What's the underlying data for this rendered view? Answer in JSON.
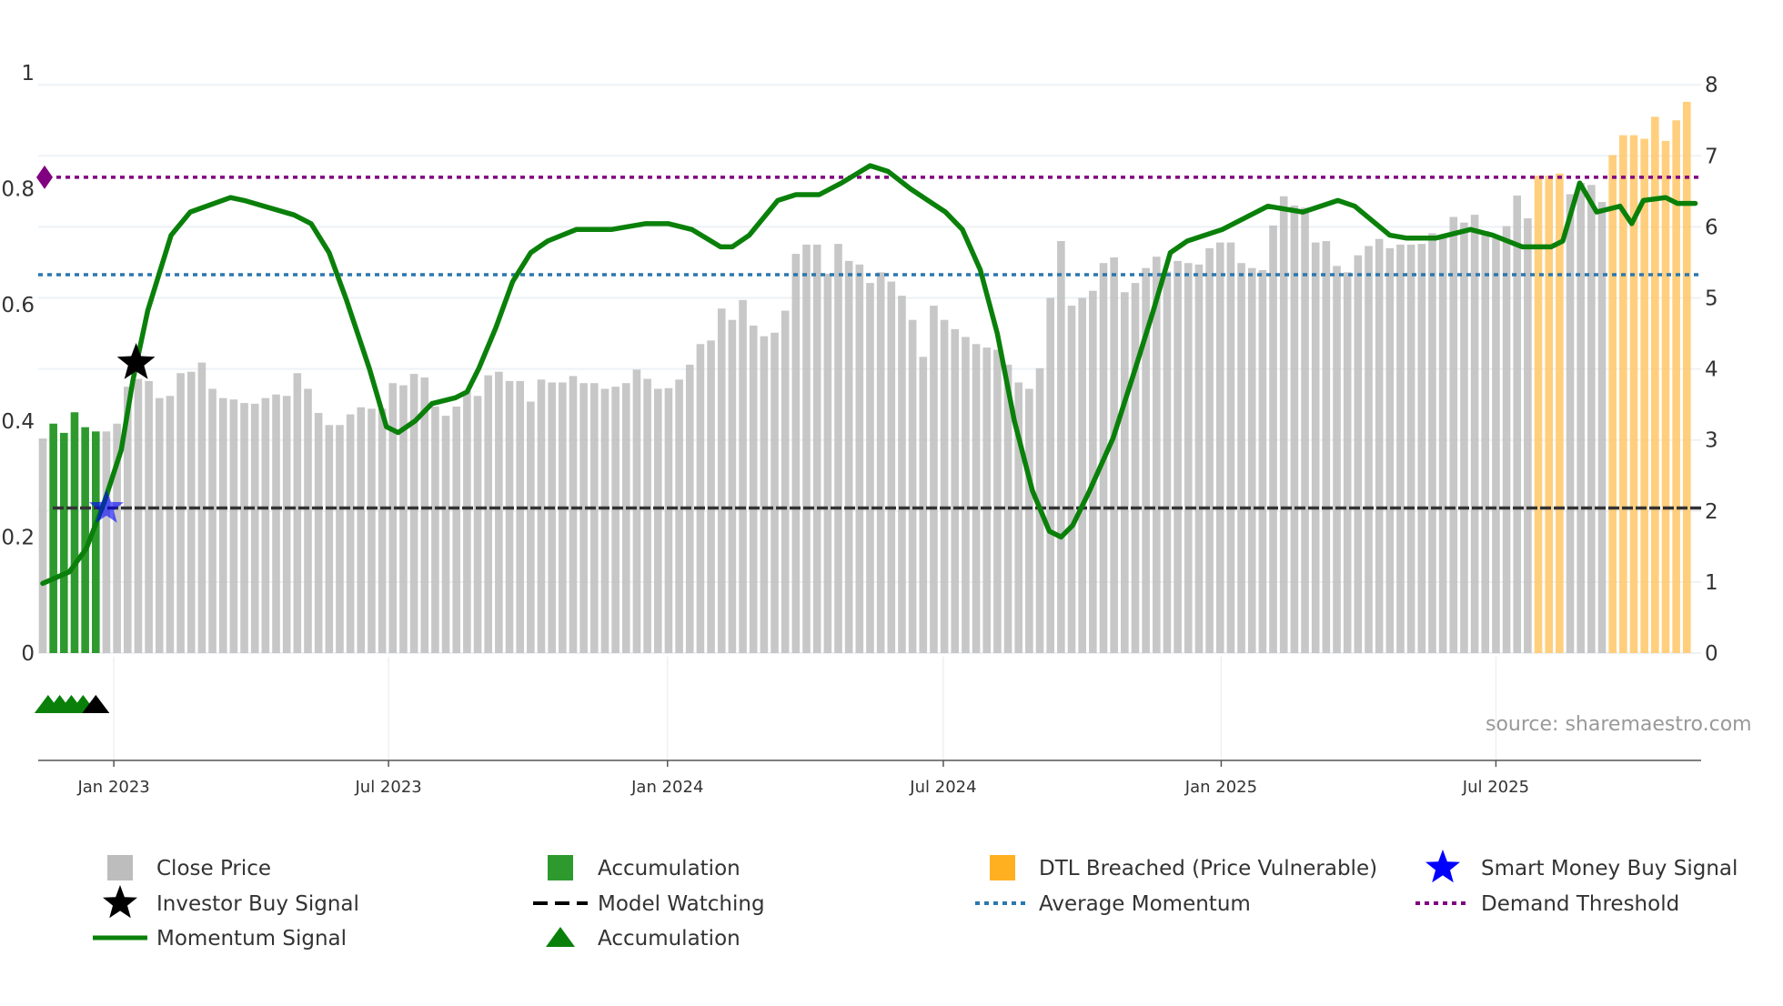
{
  "chart_data": {
    "type": "bar",
    "title": "",
    "x_unit": "week index (weekly bars, first bar mid-Nov 2022)",
    "x_ticks": [
      {
        "label": "Jan 2023",
        "week": 6.7
      },
      {
        "label": "Jul 2023",
        "week": 32.6
      },
      {
        "label": "Jan 2024",
        "week": 58.9
      },
      {
        "label": "Jul 2024",
        "week": 84.9
      },
      {
        "label": "Jan 2025",
        "week": 111.1
      },
      {
        "label": "Jul 2025",
        "week": 137
      }
    ],
    "left_axis": {
      "range": [
        0,
        1
      ],
      "ticks": [
        "0",
        "0.2",
        "0.4",
        "0.6",
        "0.8",
        "1"
      ],
      "tick_values": [
        0,
        0.2,
        0.4,
        0.6,
        0.8,
        1
      ]
    },
    "right_axis": {
      "range": [
        0,
        8
      ],
      "ticks": [
        "0",
        "1",
        "2",
        "3",
        "4",
        "5",
        "6",
        "7",
        "8"
      ],
      "tick_values": [
        0,
        1,
        2,
        3,
        4,
        5,
        6,
        7,
        8
      ]
    },
    "close_price": [
      3.02,
      3.23,
      3.1,
      3.39,
      3.18,
      3.12,
      3.12,
      3.23,
      3.75,
      3.86,
      3.83,
      3.59,
      3.62,
      3.94,
      3.96,
      4.09,
      3.72,
      3.59,
      3.57,
      3.52,
      3.51,
      3.59,
      3.64,
      3.62,
      3.94,
      3.72,
      3.38,
      3.21,
      3.21,
      3.36,
      3.46,
      3.44,
      3.44,
      3.8,
      3.77,
      3.93,
      3.88,
      3.47,
      3.34,
      3.47,
      3.69,
      3.62,
      3.91,
      3.96,
      3.83,
      3.83,
      3.54,
      3.85,
      3.81,
      3.81,
      3.9,
      3.8,
      3.8,
      3.72,
      3.75,
      3.8,
      3.99,
      3.86,
      3.72,
      3.73,
      3.85,
      4.06,
      4.35,
      4.4,
      4.85,
      4.69,
      4.97,
      4.61,
      4.46,
      4.51,
      4.82,
      5.62,
      5.75,
      5.75,
      5.34,
      5.76,
      5.52,
      5.47,
      5.21,
      5.36,
      5.23,
      5.03,
      4.69,
      4.17,
      4.89,
      4.69,
      4.56,
      4.45,
      4.35,
      4.3,
      4.27,
      4.06,
      3.81,
      3.72,
      4.01,
      5.0,
      5.8,
      4.89,
      5.0,
      5.1,
      5.49,
      5.57,
      5.08,
      5.21,
      5.42,
      5.58,
      5.37,
      5.52,
      5.49,
      5.47,
      5.7,
      5.78,
      5.78,
      5.49,
      5.42,
      5.39,
      6.02,
      6.43,
      6.3,
      6.27,
      5.78,
      5.8,
      5.45,
      5.36,
      5.6,
      5.73,
      5.83,
      5.7,
      5.75,
      5.75,
      5.76,
      5.91,
      5.86,
      6.14,
      6.06,
      6.17,
      5.94,
      5.84,
      6.01,
      6.44,
      6.12,
      6.72,
      6.72,
      6.75,
      6.46,
      6.62,
      6.59,
      6.35,
      7.01,
      7.29,
      7.29,
      7.24,
      7.55,
      7.21,
      7.5,
      7.76
    ],
    "accumulation_bars": [
      1,
      2,
      3,
      4,
      5
    ],
    "dtl_breached_bars": [
      141,
      142,
      143,
      148,
      149,
      150,
      151,
      152,
      153,
      154,
      155
    ],
    "momentum_signal": [
      [
        0,
        0.12
      ],
      [
        2.5,
        0.14
      ],
      [
        4.1,
        0.18
      ],
      [
        5.8,
        0.26
      ],
      [
        7.4,
        0.35
      ],
      [
        8.5,
        0.47
      ],
      [
        9.9,
        0.59
      ],
      [
        12.1,
        0.72
      ],
      [
        13.9,
        0.76
      ],
      [
        17.7,
        0.785
      ],
      [
        19,
        0.78
      ],
      [
        23.7,
        0.755
      ],
      [
        25.3,
        0.74
      ],
      [
        27,
        0.69
      ],
      [
        28.6,
        0.61
      ],
      [
        30.8,
        0.49
      ],
      [
        32.4,
        0.39
      ],
      [
        33.5,
        0.38
      ],
      [
        35.1,
        0.4
      ],
      [
        36.7,
        0.43
      ],
      [
        38.9,
        0.44
      ],
      [
        40,
        0.45
      ],
      [
        41.1,
        0.49
      ],
      [
        42.7,
        0.56
      ],
      [
        44.3,
        0.64
      ],
      [
        46,
        0.69
      ],
      [
        47.6,
        0.71
      ],
      [
        50.3,
        0.73
      ],
      [
        53.6,
        0.73
      ],
      [
        56.8,
        0.74
      ],
      [
        59,
        0.74
      ],
      [
        61.2,
        0.73
      ],
      [
        63.9,
        0.7
      ],
      [
        65,
        0.7
      ],
      [
        66.6,
        0.72
      ],
      [
        69.3,
        0.78
      ],
      [
        71,
        0.79
      ],
      [
        73.2,
        0.79
      ],
      [
        75.3,
        0.81
      ],
      [
        78,
        0.84
      ],
      [
        79.7,
        0.83
      ],
      [
        81.8,
        0.8
      ],
      [
        85.1,
        0.76
      ],
      [
        86.7,
        0.73
      ],
      [
        88.4,
        0.66
      ],
      [
        90,
        0.55
      ],
      [
        91.6,
        0.4
      ],
      [
        93.3,
        0.28
      ],
      [
        94.9,
        0.21
      ],
      [
        96,
        0.2
      ],
      [
        97.1,
        0.22
      ],
      [
        98.7,
        0.28
      ],
      [
        100.9,
        0.37
      ],
      [
        103,
        0.49
      ],
      [
        104.7,
        0.59
      ],
      [
        106.3,
        0.69
      ],
      [
        107.9,
        0.71
      ],
      [
        111.2,
        0.73
      ],
      [
        115.5,
        0.77
      ],
      [
        118.8,
        0.76
      ],
      [
        122.1,
        0.78
      ],
      [
        123.7,
        0.77
      ],
      [
        127,
        0.72
      ],
      [
        128.6,
        0.715
      ],
      [
        131.3,
        0.715
      ],
      [
        134.6,
        0.73
      ],
      [
        136.7,
        0.72
      ],
      [
        139.5,
        0.7
      ],
      [
        142.2,
        0.7
      ],
      [
        143.3,
        0.71
      ],
      [
        144.9,
        0.81
      ],
      [
        146.5,
        0.76
      ],
      [
        148.7,
        0.77
      ],
      [
        149.8,
        0.74
      ],
      [
        150.9,
        0.78
      ],
      [
        153,
        0.785
      ],
      [
        154.1,
        0.775
      ],
      [
        155.8,
        0.775
      ]
    ],
    "demand_threshold": 0.82,
    "average_momentum": 0.652,
    "model_watching": 0.25,
    "investor_buy_signals": [
      [
        8.8,
        0.5
      ]
    ],
    "smart_money_buy_signals": [
      [
        6,
        0.25
      ]
    ],
    "accumulation_markers": [
      0.5,
      1.6,
      2.7,
      3.8
    ],
    "investor_markers": [
      5
    ],
    "source": "source: sharemaestro.com",
    "legend": {
      "close_price": "Close Price",
      "accumulation_bar": "Accumulation",
      "dtl": "DTL Breached (Price Vulnerable)",
      "smart_money": "Smart Money Buy Signal",
      "investor": "Investor Buy Signal",
      "model_watching": "Model Watching",
      "avg_momentum": "Average Momentum",
      "demand_threshold": "Demand Threshold",
      "momentum": "Momentum Signal",
      "accumulation_marker": "Accumulation"
    },
    "colors": {
      "gray": "#bdbdbd",
      "green_bar": "#2e9a2e",
      "orange": "#ffc766",
      "line": "#0a800a",
      "avg": "#2b77ad",
      "demand": "#800080",
      "star_blue": "#0000ff"
    }
  }
}
